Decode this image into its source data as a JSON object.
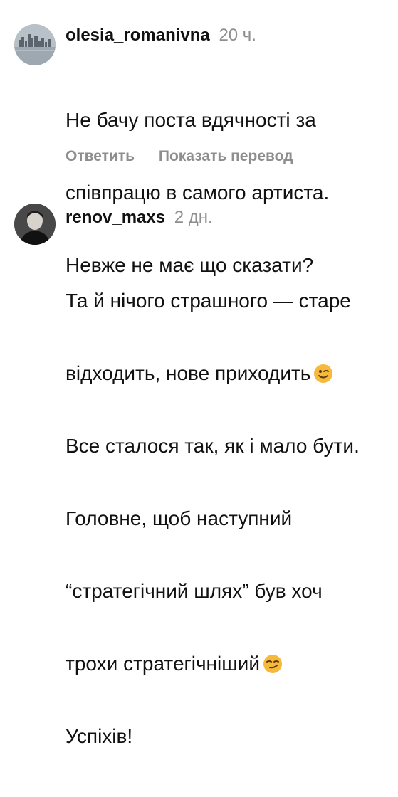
{
  "comments": [
    {
      "username": "olesia_romanivna",
      "time": "20 ч.",
      "lines": [
        "Не бачу поста вдячності за",
        "співпрацю в самого артиста.",
        "Невже не має що сказати?"
      ],
      "actions": {
        "reply": "Ответить",
        "translate": "Показать перевод"
      }
    },
    {
      "username": "renov_maxs",
      "time": "2 дн.",
      "lines": [
        "Та й нічого страшного — старе",
        "відходить, нове приходить",
        "Все сталося так, як і мало бути.",
        "Головне, щоб наступний",
        "“стратегічний шлях” був хоч",
        "трохи стратегічніший",
        "Успіхів!"
      ]
    }
  ],
  "icons": [
    "winking-face-icon",
    "smirking-face-icon"
  ],
  "colors": {
    "username": "#111111",
    "meta": "#8e8e8e",
    "emoji": "#f6b93b"
  }
}
